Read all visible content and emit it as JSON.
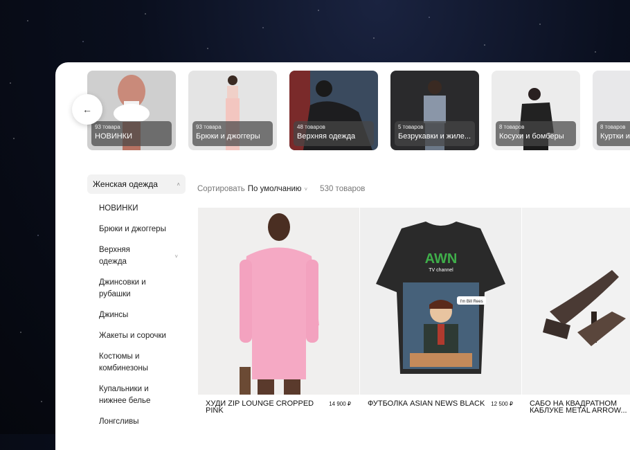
{
  "back_button": {
    "icon": "arrow-left-icon",
    "glyph": "←"
  },
  "categories": [
    {
      "count": "93 товара",
      "name": "НОВИНКИ"
    },
    {
      "count": "93 товара",
      "name": "Брюки и джоггеры"
    },
    {
      "count": "48 товаров",
      "name": "Верхняя одежда"
    },
    {
      "count": "5 товаров",
      "name": "Безрукавки и жиле..."
    },
    {
      "count": "8 товаров",
      "name": "Косухи и бомберы"
    },
    {
      "count": "8 товаров",
      "name": "Куртки и"
    }
  ],
  "sidebar": {
    "heading": "Женская одежда",
    "heading_chevron": "˄",
    "items": [
      {
        "label": "НОВИНКИ"
      },
      {
        "label": "Брюки и джоггеры"
      },
      {
        "label": "Верхняя одежда",
        "chevron": "˅"
      },
      {
        "label": "Джинсовки и рубашки"
      },
      {
        "label": "Джинсы"
      },
      {
        "label": "Жакеты и сорочки"
      },
      {
        "label": "Костюмы и комбинезоны"
      },
      {
        "label": "Купальники и нижнее белье"
      },
      {
        "label": "Лонгсливы"
      }
    ]
  },
  "sort": {
    "label": "Сортировать",
    "value": "По умолчанию",
    "dropdown": "˅",
    "count": "530 товаров"
  },
  "products": [
    {
      "name": "ХУДИ ZIP LOUNGE CROPPED PINK",
      "price": "14 900 ₽"
    },
    {
      "name": "ФУТБОЛКА ASIAN NEWS BLACK",
      "price": "12 500 ₽",
      "print_title": "AWN",
      "print_sub": "TV channel",
      "bubble": "I'm Bill Rees"
    },
    {
      "name": "САБО НА КВАДРАТНОМ КАБЛУКЕ METAL ARROW...",
      "price": ""
    }
  ],
  "colors": {
    "panel": "#ffffff",
    "accent_pink": "#f5a9c4",
    "tee_green": "#3fae4a"
  }
}
